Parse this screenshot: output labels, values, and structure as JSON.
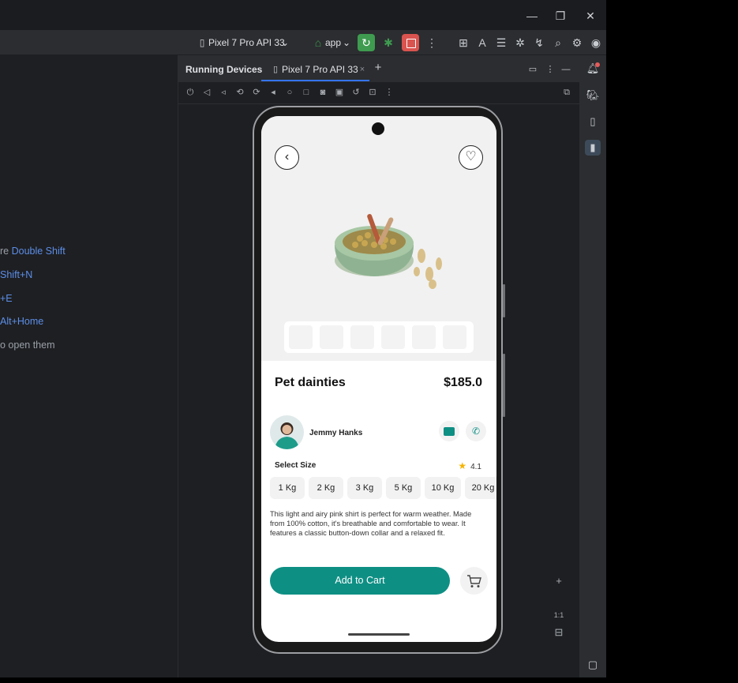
{
  "window": {
    "minimize_icon": "minimize-icon",
    "restore_icon": "restore-icon",
    "close_icon": "close-icon"
  },
  "toolbar": {
    "device_selector": "Pixel 7 Pro API 33",
    "run_config": "app"
  },
  "welcome_hints": [
    {
      "text": "re ",
      "kbd": "Double Shift"
    },
    {
      "text": "",
      "kbd": "Shift+N"
    },
    {
      "text": "",
      "kbd": "+E"
    },
    {
      "text": "",
      "kbd": "Alt+Home"
    },
    {
      "text": "o open them",
      "kbd": ""
    }
  ],
  "device_panel": {
    "tab_running": "Running Devices",
    "tab_device": "Pixel 7 Pro API 33",
    "close_tab_glyph": "×",
    "add_tab_glyph": "+"
  },
  "zoom_controls": {
    "plus": "+",
    "one_to_one": "1:1"
  },
  "app": {
    "product_title": "Pet dainties",
    "price": "$185.0",
    "seller_name": "Jemmy Hanks",
    "select_size_label": "Select Size",
    "rating": "4.1",
    "sizes": [
      "1 Kg",
      "2 Kg",
      "3 Kg",
      "5 Kg",
      "10 Kg",
      "20 Kg"
    ],
    "description": "This light and airy pink shirt is perfect for warm weather. Made from 100% cotton, it's breathable and comfortable to wear. It features a classic button-down collar and a relaxed fit.",
    "add_to_cart_label": "Add to Cart",
    "back_glyph": "‹",
    "favorite_glyph": "♡"
  },
  "colors": {
    "ide_bg": "#1e1f22",
    "accent_blue": "#3574f0",
    "run_green": "#3e9b4f",
    "stop_red": "#d9534f",
    "app_teal": "#0e8f84"
  }
}
